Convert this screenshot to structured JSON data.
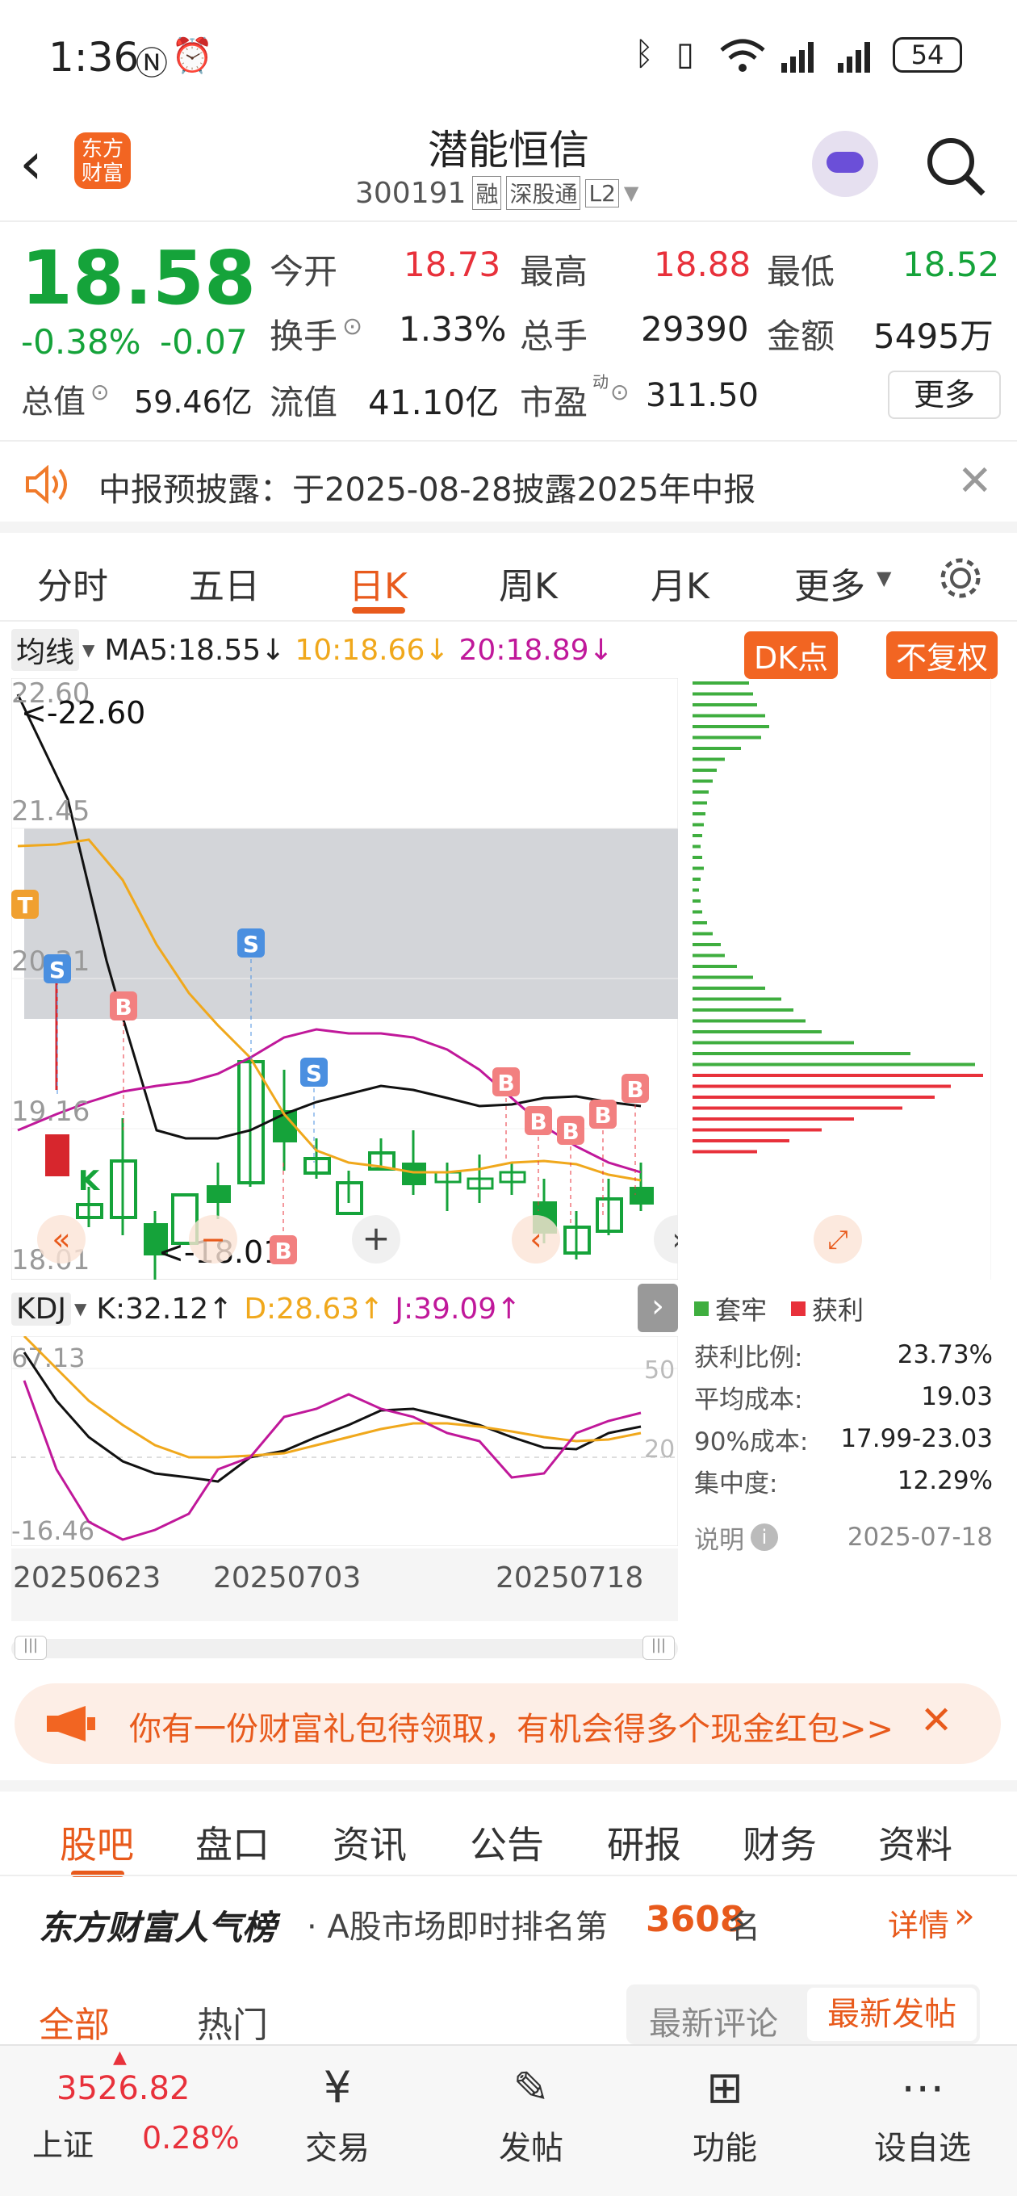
{
  "status": {
    "time": "1:36",
    "battery": "54"
  },
  "header": {
    "title": "潜能恒信",
    "code": "300191",
    "tags": [
      "融",
      "深股通",
      "L2"
    ],
    "logo_text": "东方财富"
  },
  "quote": {
    "price": "18.58",
    "change_pct": "-0.38%",
    "change": "-0.07",
    "fields": [
      {
        "label": "今开",
        "value": "18.73",
        "color": "#e8313b"
      },
      {
        "label": "最高",
        "value": "18.88",
        "color": "#e8313b"
      },
      {
        "label": "最低",
        "value": "18.52",
        "color": "#15a33a"
      },
      {
        "label": "换手",
        "value": "1.33%",
        "color": "#222"
      },
      {
        "label": "总手",
        "value": "29390",
        "color": "#222"
      },
      {
        "label": "金额",
        "value": "5495万",
        "color": "#222"
      },
      {
        "label": "总值",
        "value": "59.46亿",
        "color": "#222"
      },
      {
        "label": "流值",
        "value": "41.10亿",
        "color": "#222"
      },
      {
        "label": "市盈",
        "value": "311.50",
        "color": "#222"
      }
    ],
    "pe_sup": "动",
    "more": "更多"
  },
  "notice": {
    "text": "中报预披露：于2025-08-28披露2025年中报"
  },
  "period_tabs": [
    "分时",
    "五日",
    "日K",
    "周K",
    "月K",
    "更多"
  ],
  "active_tab": "日K",
  "ma": {
    "selector": "均线",
    "ma5": "MA5:18.55↓",
    "ma10": "10:18.66↓",
    "ma20": "20:18.89↓",
    "dk": "DK点",
    "fq": "不复权"
  },
  "kline": {
    "y_labels": [
      "22.60",
      "21.45",
      "20.31",
      "19.16",
      "18.01"
    ],
    "max_label": "<-22.60",
    "min_label": "<-18.01",
    "markers": [
      "S",
      "B",
      "S",
      "S",
      "B",
      "B",
      "B",
      "B",
      "B",
      "B",
      "T",
      "K"
    ]
  },
  "kdj": {
    "selector": "KDJ",
    "k": "K:32.12↑",
    "d": "D:28.63↑",
    "j": "J:39.09↑",
    "top": "67.13",
    "bottom": "-16.46",
    "ref50": "50",
    "ref20": "20"
  },
  "dates": [
    "20250623",
    "20250703",
    "20250718"
  ],
  "chips": {
    "legend_a": "套牢",
    "legend_b": "获利",
    "rows": [
      {
        "label": "获利比例:",
        "value": "23.73%"
      },
      {
        "label": "平均成本:",
        "value": "19.03"
      },
      {
        "label": "90%成本:",
        "value": "17.99-23.03"
      },
      {
        "label": "集中度:",
        "value": "12.29%"
      }
    ],
    "note": "说明",
    "date": "2025-07-18"
  },
  "ad": {
    "text": "你有一份财富礼包待领取，有机会得多个现金红包>>"
  },
  "sub_tabs": [
    "股吧",
    "盘口",
    "资讯",
    "公告",
    "研报",
    "财务",
    "资料"
  ],
  "ranking": {
    "brand": "东方财富人气榜",
    "text_pre": "· A股市场即时排名第",
    "rank": "3608",
    "text_post": "名",
    "detail": "详情"
  },
  "filters": {
    "all": "全部",
    "hot": "热门",
    "latest_comment": "最新评论",
    "latest_post": "最新发帖"
  },
  "index": {
    "value": "3526.82",
    "name": "上证",
    "pct": "0.28%"
  },
  "bottom_nav": [
    "交易",
    "发帖",
    "功能",
    "设自选"
  ]
}
